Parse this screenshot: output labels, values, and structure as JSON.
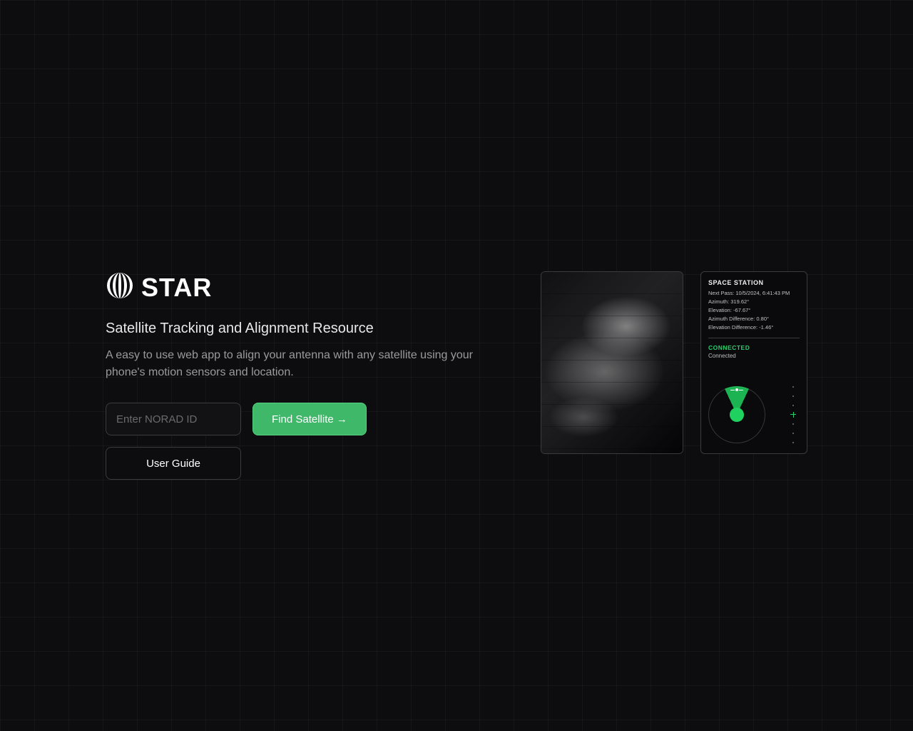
{
  "brand": {
    "name": "STAR",
    "subtitle": "Satellite Tracking and Alignment Resource",
    "description": "A easy to use web app to align your antenna with any satellite using your phone's motion sensors and location."
  },
  "form": {
    "norad_placeholder": "Enter NORAD ID",
    "norad_value": "",
    "find_label": "Find Satellite →",
    "guide_label": "User Guide"
  },
  "preview": {
    "title": "SPACE STATION",
    "next_pass": "Next Pass: 10/5/2024, 6:41:43 PM",
    "azimuth": "Azimuth: 319.62°",
    "elevation": "Elevation: -67.67°",
    "az_diff": "Azimuth Difference: 0.80°",
    "el_diff": "Elevation Difference: -1.46°",
    "connected_label": "CONNECTED",
    "connected_sub": "Connected"
  },
  "colors": {
    "accent": "#3fb86a",
    "status": "#27d06b"
  }
}
